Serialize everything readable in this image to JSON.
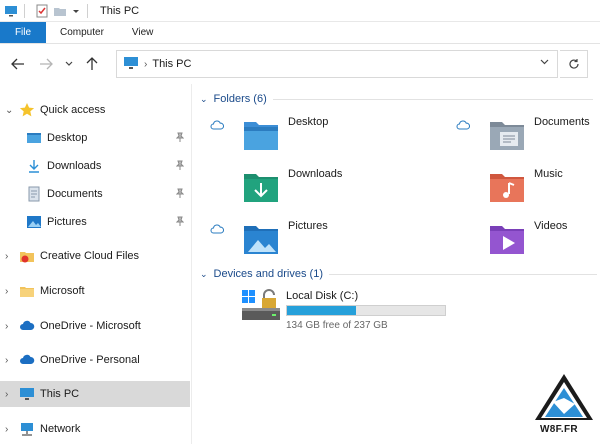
{
  "window": {
    "title": "This PC"
  },
  "ribbon": {
    "tabs": [
      "File",
      "Computer",
      "View"
    ]
  },
  "address": {
    "path": "This PC"
  },
  "nav": {
    "quick_access": "Quick access",
    "quick_children": [
      "Desktop",
      "Downloads",
      "Documents",
      "Pictures"
    ],
    "roots": [
      "Creative Cloud Files",
      "Microsoft",
      "OneDrive - Microsoft",
      "OneDrive - Personal",
      "This PC",
      "Network"
    ]
  },
  "folders": {
    "header": "Folders (6)",
    "items": [
      "Desktop",
      "Documents",
      "Downloads",
      "Music",
      "Pictures",
      "Videos"
    ]
  },
  "drives": {
    "header": "Devices and drives (1)",
    "items": [
      {
        "name": "Local Disk (C:)",
        "free_text": "134 GB free of 237 GB",
        "used_fraction": 0.435
      }
    ]
  },
  "watermark": {
    "text": "W8F.FR"
  },
  "colors": {
    "accent": "#1979ca",
    "bar_fill": "#26a0da",
    "header_text": "#1a4a8a"
  }
}
